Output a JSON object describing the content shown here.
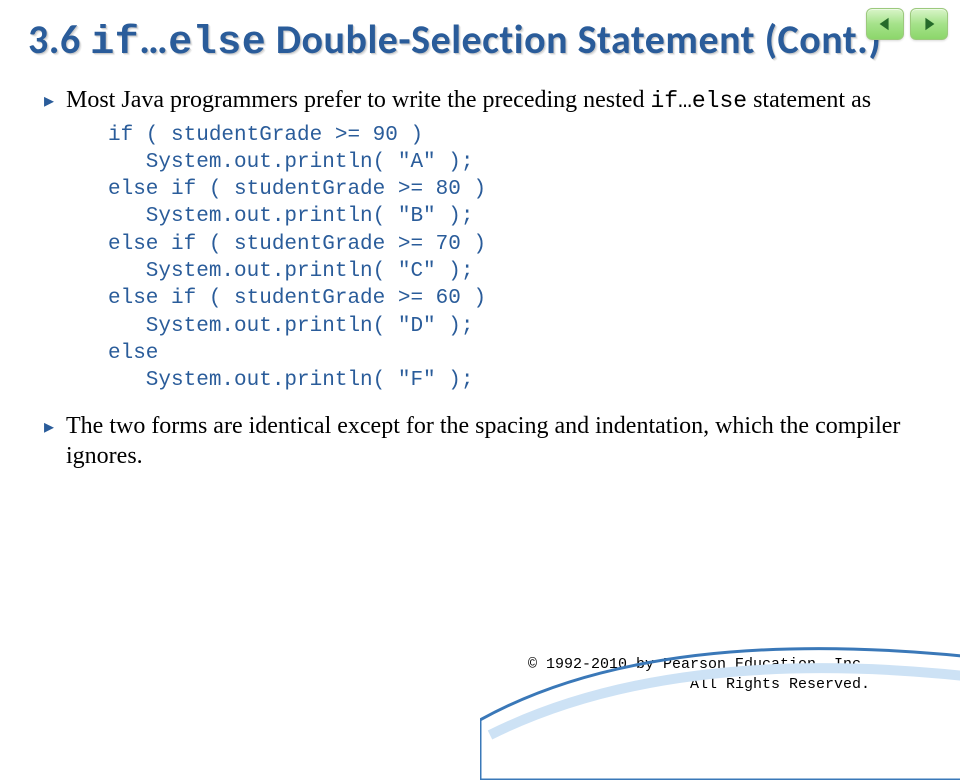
{
  "title": {
    "section": "3.6",
    "mono1": "if",
    "ellipsis": "…",
    "mono2": "else",
    "rest": " Double-Selection Statement (Cont.)"
  },
  "bullets": {
    "b1_pre": "Most Java programmers prefer to write the preceding nested ",
    "b1_mono": "if…else",
    "b1_post": " statement as",
    "b2": "The two forms are identical except for the spacing and indentation, which the compiler ignores."
  },
  "code": "if ( studentGrade >= 90 )\n   System.out.println( \"A\" );\nelse if ( studentGrade >= 80 )\n   System.out.println( \"B\" );\nelse if ( studentGrade >= 70 )\n   System.out.println( \"C\" );\nelse if ( studentGrade >= 60 )\n   System.out.println( \"D\" );\nelse\n   System.out.println( \"F\" );",
  "footer": {
    "line1": "© 1992-2010 by Pearson Education, Inc.",
    "line2": "All Rights Reserved."
  },
  "colors": {
    "accent": "#2a5c9a",
    "nav_fill": "#256a2a"
  }
}
